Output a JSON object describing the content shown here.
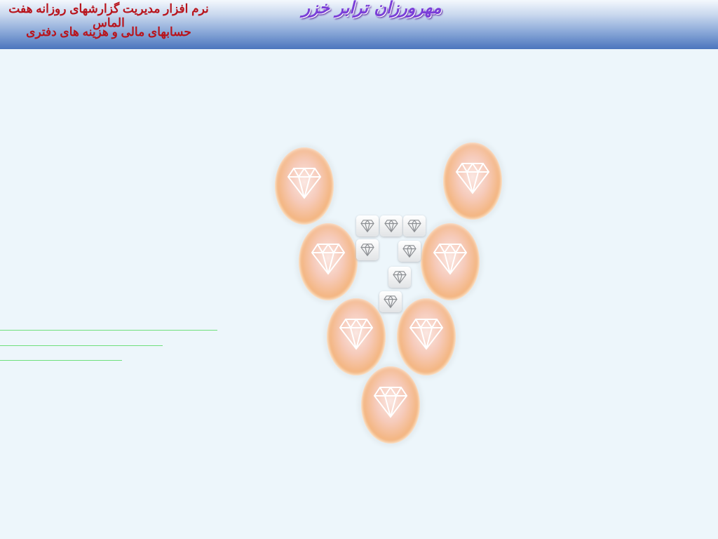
{
  "header": {
    "company_name": "مهرورزان ترابر خزر",
    "app_title_line1": "نرم افزار مدیریت گزارشهای روزانه هفت الماس",
    "app_title_line2": "حسابهای مالی و هزینه های دفتری"
  },
  "colors": {
    "header_gradient_top": "#f4f8fd",
    "header_gradient_bottom": "#4b75bd",
    "company_text": "#7b3fd8",
    "title_text": "#b8141c",
    "page_background": "#edf6fb",
    "menu_lines": "#6fe07c",
    "gem_fill": "#f4b682"
  },
  "icons": {
    "large_gem": "diamond-icon",
    "small_gem": "diamond-icon"
  }
}
